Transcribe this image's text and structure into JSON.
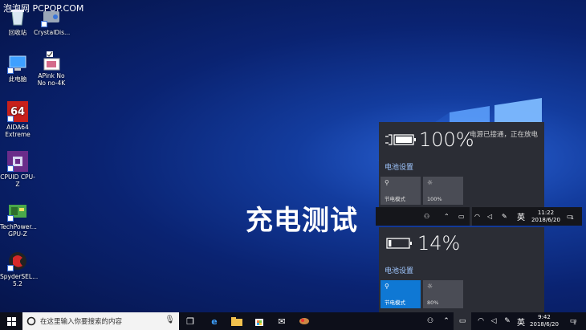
{
  "watermark": "泡泡网 PCPOP.COM",
  "desktop_icons": [
    {
      "label": "回收站"
    },
    {
      "label": "CrystalDis..."
    },
    {
      "label": "此电脑"
    },
    {
      "label": "APink No No no-4K"
    },
    {
      "label": "AIDA64 Extreme",
      "badge": "64"
    },
    {
      "label": "CPUID CPU-Z"
    },
    {
      "label": "TechPower... GPU-Z"
    },
    {
      "label": "SpyderSEL... 5.2"
    }
  ],
  "overlay_title": "充电测试",
  "top_flyout": {
    "percent": "100%",
    "status": "电源已接通，正在放电",
    "battery_settings": "电池设置",
    "tiles": [
      {
        "label": "节电模式",
        "icon": "lightbulb-icon",
        "active": false
      },
      {
        "label": "100%",
        "icon": "brightness-icon",
        "active": false
      }
    ],
    "battery_level": 1.0
  },
  "top_tray": {
    "ime": "英",
    "time": "11:22",
    "date": "2018/6/20",
    "notification_count": "1"
  },
  "bottom_flyout": {
    "percent": "14%",
    "battery_settings": "电池设置",
    "tiles": [
      {
        "label": "节电模式",
        "icon": "lightbulb-icon",
        "active": true
      },
      {
        "label": "80%",
        "icon": "brightness-icon",
        "active": false
      }
    ],
    "battery_level": 0.14
  },
  "taskbar": {
    "search_placeholder": "在这里输入你要搜索的内容",
    "ime": "英",
    "time": "9:42",
    "date": "2018/6/20",
    "notification_count": "1"
  },
  "colors": {
    "accent": "#0f78d4",
    "flyout_bg": "#2b2d35",
    "taskbar_bg": "#0d0f1a"
  }
}
